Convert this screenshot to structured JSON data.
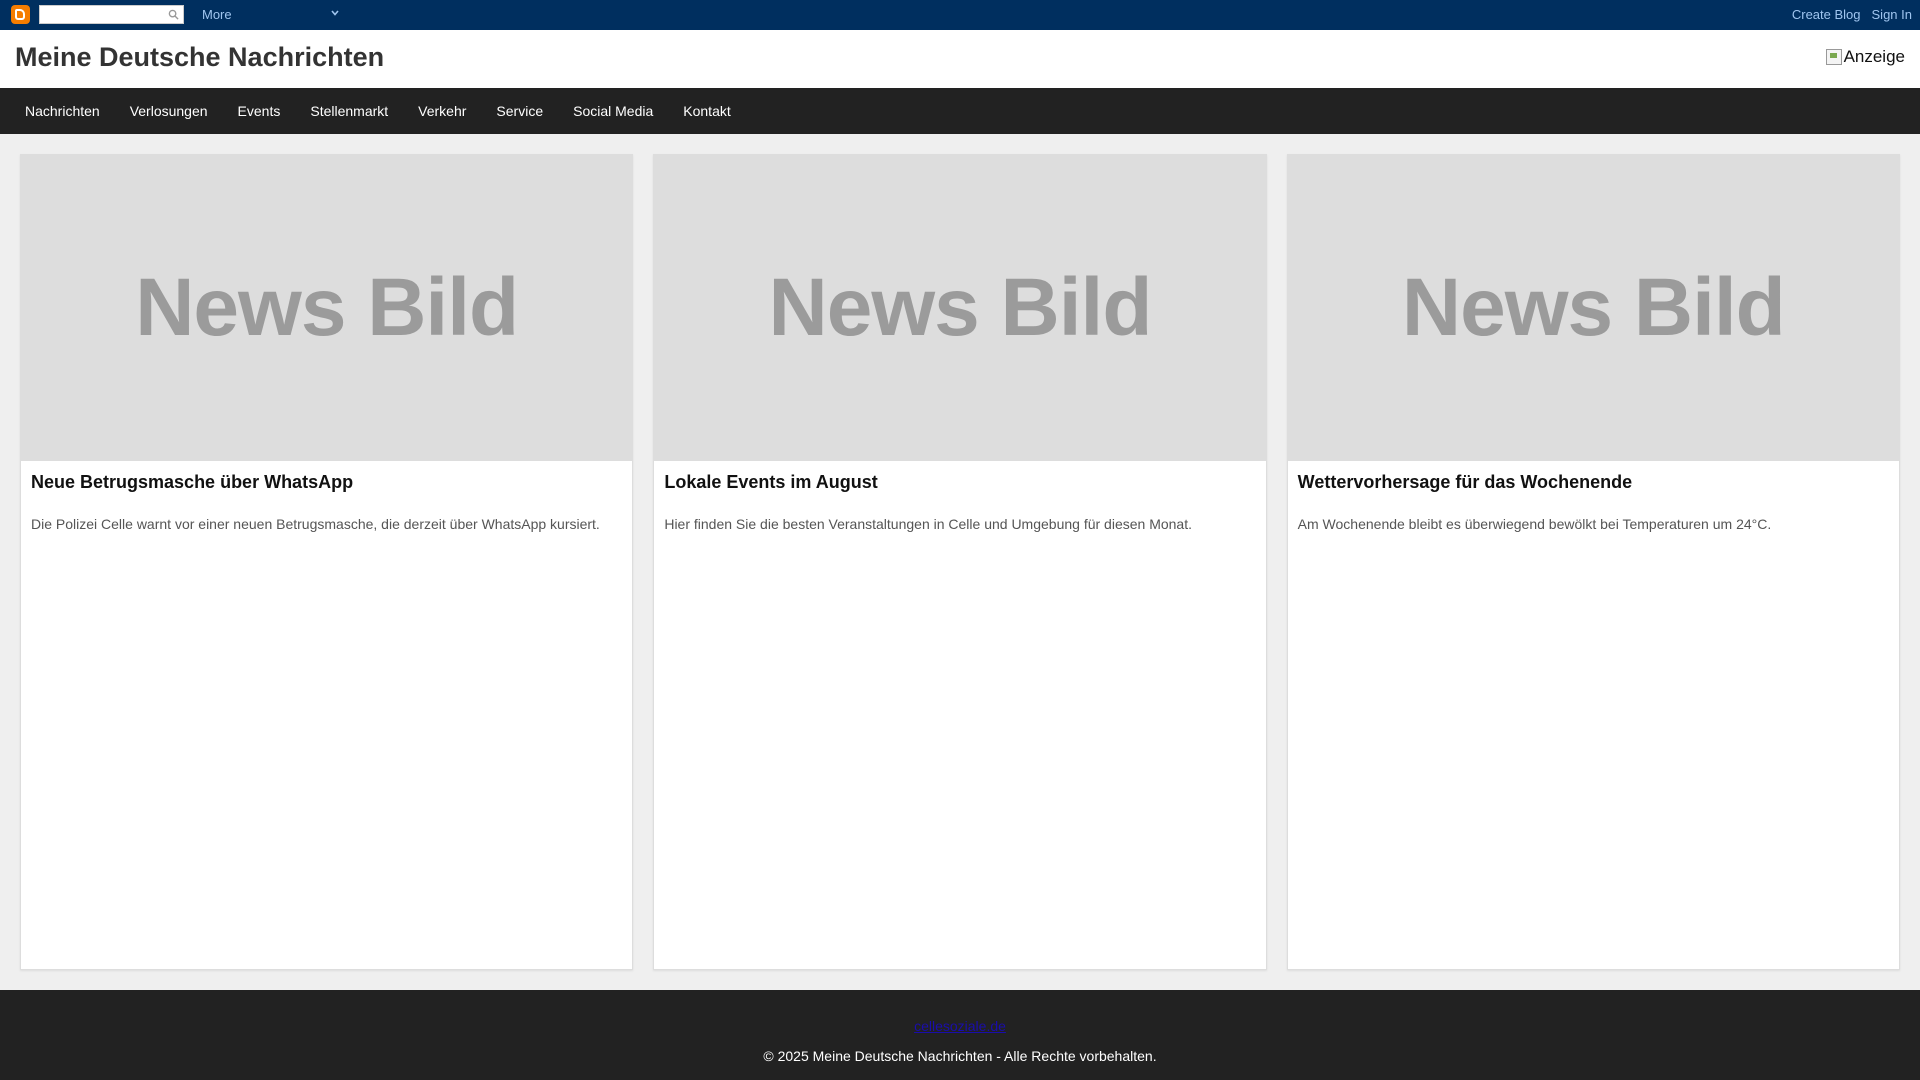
{
  "navbar": {
    "search_placeholder": "",
    "more_label": "More",
    "create_blog": "Create Blog",
    "sign_in": "Sign In"
  },
  "header": {
    "title": "Meine Deutsche Nachrichten",
    "ad_alt": "Anzeige"
  },
  "nav": {
    "items": [
      {
        "label": "Nachrichten"
      },
      {
        "label": "Verlosungen"
      },
      {
        "label": "Events"
      },
      {
        "label": "Stellenmarkt"
      },
      {
        "label": "Verkehr"
      },
      {
        "label": "Service"
      },
      {
        "label": "Social Media"
      },
      {
        "label": "Kontakt"
      }
    ]
  },
  "cards": [
    {
      "image_label": "News Bild",
      "title": "Neue Betrugsmasche über WhatsApp",
      "text": "Die Polizei Celle warnt vor einer neuen Betrugsmasche, die derzeit über WhatsApp kursiert."
    },
    {
      "image_label": "News Bild",
      "title": "Lokale Events im August",
      "text": "Hier finden Sie die besten Veranstaltungen in Celle und Umgebung für diesen Monat."
    },
    {
      "image_label": "News Bild",
      "title": "Wettervorhersage für das Wochenende",
      "text": "Am Wochenende bleibt es überwiegend bewölkt bei Temperaturen um 24°C."
    }
  ],
  "footer": {
    "link": "cellesoziale.de",
    "copyright": "© 2025 Meine Deutsche Nachrichten - Alle Rechte vorbehalten."
  },
  "colors": {
    "navbar_bg": "#002f5f",
    "mainnav_bg": "#222222",
    "placeholder_bg": "#dddddd"
  }
}
